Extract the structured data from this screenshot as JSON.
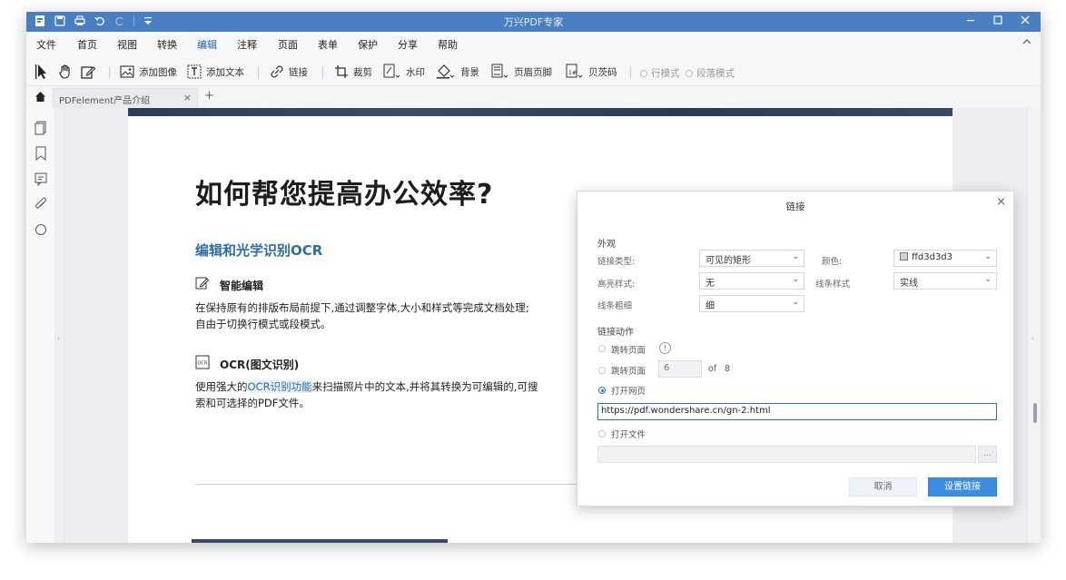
{
  "window": {
    "title": "万兴PDF专家"
  },
  "menu": {
    "items": [
      "文件",
      "首页",
      "视图",
      "转换",
      "编辑",
      "注释",
      "页面",
      "表单",
      "保护",
      "分享",
      "帮助"
    ],
    "active": "编辑"
  },
  "toolbar": {
    "add_image": "添加图像",
    "add_text": "添加文本",
    "link": "链接",
    "crop": "裁剪",
    "watermark": "水印",
    "background": "背景",
    "header_footer": "页眉页脚",
    "bates": "贝茨码",
    "line_mode": "行模式",
    "paragraph_mode": "段落模式"
  },
  "tabs": {
    "doc_tab": "PDFelement产品介绍",
    "close": "×",
    "add": "+"
  },
  "document": {
    "heading": "如何帮您提高办公效率?",
    "subheading": "编辑和光学识别OCR",
    "feature1_title": "智能编辑",
    "feature1_text_line1": "在保持原有的排版布局前提下,通过调整字体,大小和样式等完成文档处理;",
    "feature1_text_line2": "自由于切换行模式或段模式。",
    "feature2_title": "OCR(图文识别)",
    "feature2_text_pre": "使用强大的",
    "feature2_text_hl": "OCR识别功能",
    "feature2_text_post": "来扫描照片中的文本,并将其转换为可编辑的,可搜",
    "feature2_text_line2": "索和可选择的PDF文件。"
  },
  "dialog": {
    "title": "链接",
    "close": "×",
    "appearance_title": "外观",
    "link_type_label": "链接类型:",
    "link_type_value": "可见的矩形",
    "color_label": "颜色:",
    "color_value": "ffd3d3d3",
    "highlight_label": "高亮样式:",
    "highlight_value": "无",
    "line_style_label": "线条样式",
    "line_style_value": "实线",
    "line_width_label": "线条粗细",
    "line_width_value": "细",
    "action_title": "链接动作",
    "goto_page_label_1": "跳转页面",
    "goto_page_label_2": "跳转页面",
    "page_number": "6",
    "of_label": "of",
    "total_pages": "8",
    "open_web_label": "打开网页",
    "url_value": "https://pdf.wondershare.cn/gn-2.html",
    "open_file_label": "打开文件",
    "browse": "...",
    "cancel": "取消",
    "set_link": "设置链接"
  },
  "colors": {
    "titlebar": "#4a7fc1",
    "accent": "#2f6fc6",
    "primary_button": "#3d8ee0"
  }
}
